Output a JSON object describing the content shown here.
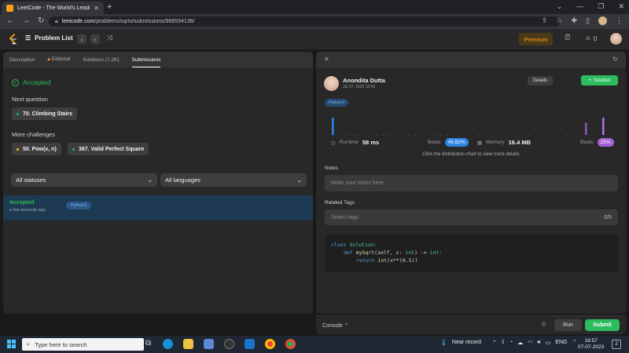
{
  "browser": {
    "tab_title": "LeetCode - The World's Leading",
    "new_tab": "+",
    "url_host": "leetcode.com",
    "url_path": "/problems/sqrtx/submissions/988594136/"
  },
  "nav": {
    "problem_list": "Problem List",
    "premium": "Premium",
    "streak_count": "0"
  },
  "left_tabs": [
    {
      "label": "Description"
    },
    {
      "label": "Editorial"
    },
    {
      "label": "Solutions (7.2K)"
    },
    {
      "label": "Submissions"
    }
  ],
  "result": {
    "status": "Accepted",
    "next_question_label": "Next question",
    "next_question": "70. Climbing Stairs",
    "more_challenges_label": "More challenges",
    "challenges": [
      "50. Pow(x, n)",
      "367. Valid Perfect Square"
    ]
  },
  "filters": {
    "status": "All statuses",
    "language": "All languages"
  },
  "submission_row": {
    "status": "Accepted",
    "time": "a few seconds ago",
    "language": "Python3"
  },
  "detail": {
    "author": "Anondita Dutta",
    "date": "Jul 07, 2023 18:56",
    "details_btn": "Details",
    "solution_btn": "Solution",
    "language_tag": "Python3",
    "runtime_label": "Runtime",
    "runtime_value": "58 ms",
    "beats_label": "Beats",
    "runtime_beats": "45.82%",
    "memory_label": "Memory",
    "memory_value": "16.4 MB",
    "memory_beats": "25%",
    "hint": "Click the distribution chart to view more details",
    "notes_label": "Notes",
    "notes_placeholder": "Write your notes here",
    "tags_label": "Related Tags",
    "tags_placeholder": "Select tags",
    "tags_count": "0/5",
    "code_line1_kw": "class",
    "code_line1_name": "Solution:",
    "code_line2_kw": "def",
    "code_line2_fn": "mySqrt",
    "code_line2_args": "(self, x:",
    "code_line2_type": "int",
    "code_line2_arrow": ") ->",
    "code_line2_ret": "int:",
    "code_line3_kw": "return",
    "code_line3_fn": "int",
    "code_line3_rest": "(x**(0.5))"
  },
  "bottom": {
    "console": "Console",
    "run": "Run",
    "submit": "Submit"
  },
  "chart_data": {
    "type": "bar",
    "runtime_bars": [
      {
        "height": 1.0,
        "color": "#2e84e6"
      }
    ],
    "memory_bars": [
      {
        "height": 0.7,
        "color": "#8e5ab8"
      },
      {
        "height": 1.0,
        "color": "#b66be8"
      }
    ]
  },
  "taskbar": {
    "search_placeholder": "Type here to search",
    "weather": "Near record",
    "lang": "ENG",
    "time": "18:57",
    "date": "07-07-2023",
    "notif_count": "2"
  },
  "colors": {
    "accent_green": "#2cbb5d",
    "premium": "#ffa116",
    "runtime_pill": "#2e84e6",
    "memory_pill": "#a45fd8"
  }
}
